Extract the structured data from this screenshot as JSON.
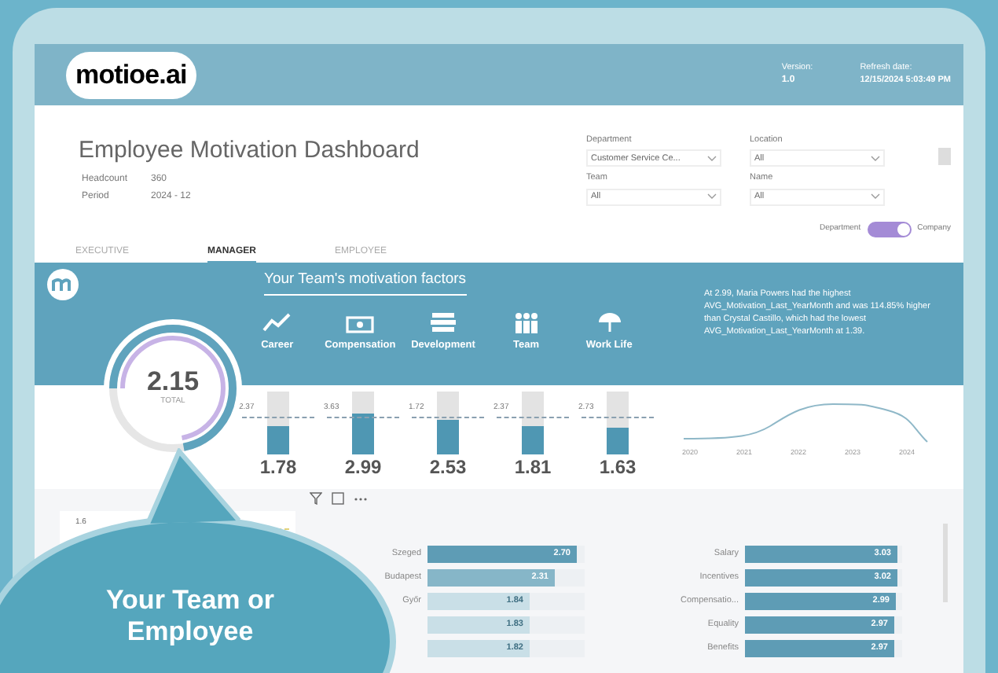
{
  "header": {
    "logo": "motioe.ai",
    "version_label": "Version:",
    "version": "1.0",
    "refresh_label": "Refresh date:",
    "refresh_date": "12/15/2024 5:03:49 PM"
  },
  "title": "Employee Motivation Dashboard",
  "info": [
    {
      "label": "Headcount",
      "value": "360"
    },
    {
      "label": "Period",
      "value": "2024 - 12"
    }
  ],
  "filters": [
    {
      "label": "Department",
      "value": "Customer Service Ce..."
    },
    {
      "label": "Location",
      "value": "All"
    },
    {
      "label": "Team",
      "value": "All"
    },
    {
      "label": "Name",
      "value": "All"
    }
  ],
  "tabs": [
    {
      "label": "EXECUTIVE",
      "selected": false
    },
    {
      "label": "MANAGER",
      "selected": true
    },
    {
      "label": "EMPLOYEE",
      "selected": false
    }
  ],
  "toggle": {
    "left": "Department",
    "right": "Company",
    "on": true
  },
  "section_title": "Your Team's motivation factors",
  "gauge": {
    "value": "2.15",
    "label": "TOTAL",
    "level": 0.72
  },
  "factors": [
    {
      "name": "Career",
      "value": "1.78",
      "target": "2.37",
      "level": 0.45
    },
    {
      "name": "Compensation",
      "value": "2.99",
      "target": "3.63",
      "level": 0.66
    },
    {
      "name": "Development",
      "value": "2.53",
      "target": "1.72",
      "level": 0.55
    },
    {
      "name": "Team",
      "value": "1.81",
      "target": "2.37",
      "level": 0.45
    },
    {
      "name": "Work Life",
      "value": "1.63",
      "target": "2.73",
      "level": 0.42
    }
  ],
  "insight": "At 2.99, Maria Powers had the highest AVG_Motivation_Last_YearMonth and was 114.85% higher than Crystal Castillo, which had the lowest AVG_Motivation_Last_YearMonth at 1.39.",
  "trend_years": [
    "2020",
    "2021",
    "2022",
    "2023",
    "2024"
  ],
  "small_chart_tick": "1.6",
  "locations": [
    {
      "label": "Szeged",
      "value": "2.70",
      "level": 0.95
    },
    {
      "label": "Budapest",
      "value": "2.31",
      "level": 0.81
    },
    {
      "label": "Győr",
      "value": "1.84",
      "level": 0.65
    },
    {
      "value": "1.83",
      "level": 0.65
    },
    {
      "value": "1.82",
      "level": 0.65
    }
  ],
  "drivers": [
    {
      "label": "Salary",
      "value": "3.03",
      "level": 0.97
    },
    {
      "label": "Incentives",
      "value": "3.02",
      "level": 0.97
    },
    {
      "label": "Compensatio...",
      "value": "2.99",
      "level": 0.96
    },
    {
      "label": "Equality",
      "value": "2.97",
      "level": 0.95
    },
    {
      "label": "Benefits",
      "value": "2.97",
      "level": 0.95
    }
  ],
  "callout": "Your Team or Employee"
}
